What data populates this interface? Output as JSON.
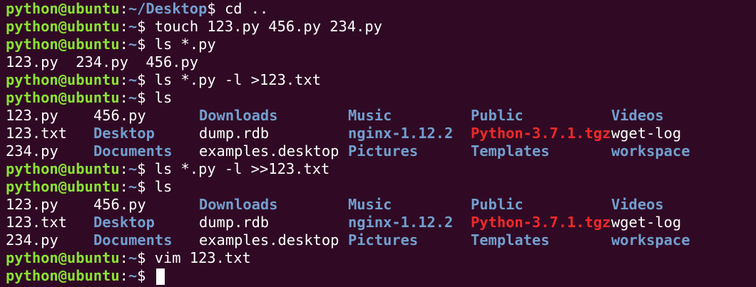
{
  "prompt": {
    "user": "python@ubuntu",
    "colon": ":"
  },
  "lines": [
    {
      "type": "prompt",
      "path": "~/Desktop",
      "symbol": "$ ",
      "cmd": "cd .."
    },
    {
      "type": "prompt",
      "path": "~",
      "symbol": "$ ",
      "cmd": "touch 123.py 456.py 234.py"
    },
    {
      "type": "prompt",
      "path": "~",
      "symbol": "$ ",
      "cmd": "ls *.py"
    },
    {
      "type": "output",
      "text": "123.py  234.py  456.py"
    },
    {
      "type": "prompt",
      "path": "~",
      "symbol": "$ ",
      "cmd": "ls *.py -l >123.txt"
    },
    {
      "type": "prompt",
      "path": "~",
      "symbol": "$ ",
      "cmd": "ls"
    },
    {
      "type": "ls",
      "row": 0
    },
    {
      "type": "ls",
      "row": 1
    },
    {
      "type": "ls",
      "row": 2
    },
    {
      "type": "prompt",
      "path": "~",
      "symbol": "$ ",
      "cmd": "ls *.py -l >>123.txt"
    },
    {
      "type": "prompt",
      "path": "~",
      "symbol": "$ ",
      "cmd": "ls"
    },
    {
      "type": "ls",
      "row": 0
    },
    {
      "type": "ls",
      "row": 1
    },
    {
      "type": "ls",
      "row": 2
    },
    {
      "type": "prompt",
      "path": "~",
      "symbol": "$ ",
      "cmd": "vim 123.txt"
    },
    {
      "type": "prompt",
      "path": "~",
      "symbol": "$ ",
      "cmd": "",
      "cursor": true
    }
  ],
  "ls_listing": [
    [
      {
        "name": "123.py",
        "kind": "file"
      },
      {
        "name": "456.py",
        "kind": "file"
      },
      {
        "name": "Downloads",
        "kind": "dir"
      },
      {
        "name": "Music",
        "kind": "dir"
      },
      {
        "name": "Public",
        "kind": "dir"
      },
      {
        "name": "Videos",
        "kind": "dir"
      }
    ],
    [
      {
        "name": "123.txt",
        "kind": "file"
      },
      {
        "name": "Desktop",
        "kind": "dir"
      },
      {
        "name": "dump.rdb",
        "kind": "file"
      },
      {
        "name": "nginx-1.12.2",
        "kind": "dir"
      },
      {
        "name": "Python-3.7.1.tgz",
        "kind": "archive"
      },
      {
        "name": "wget-log",
        "kind": "file"
      }
    ],
    [
      {
        "name": "234.py",
        "kind": "file"
      },
      {
        "name": "Documents",
        "kind": "dir"
      },
      {
        "name": "examples.desktop",
        "kind": "file"
      },
      {
        "name": "Pictures",
        "kind": "dir"
      },
      {
        "name": "Templates",
        "kind": "dir"
      },
      {
        "name": "workspace",
        "kind": "dir"
      }
    ]
  ],
  "colors": {
    "background": "#300a24",
    "user": "#8ae234",
    "path": "#729fcf",
    "directory": "#729fcf",
    "archive": "#ef2929",
    "text": "#ffffff"
  }
}
